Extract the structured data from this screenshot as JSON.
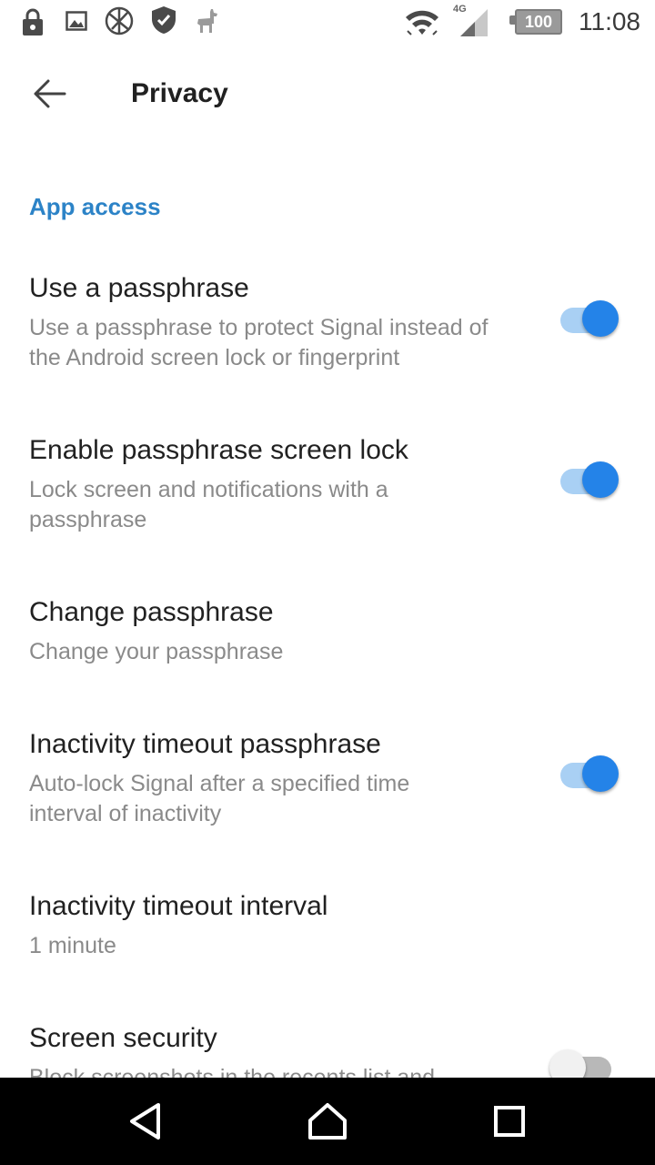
{
  "status_bar": {
    "time": "11:08",
    "battery": "100",
    "network_type": "4G",
    "icons": [
      "lock-icon",
      "image-icon",
      "globe-icon",
      "shield-icon",
      "llama-icon",
      "wifi-icon",
      "signal-icon",
      "battery-icon"
    ]
  },
  "toolbar": {
    "title": "Privacy",
    "back_icon": "back-arrow-icon"
  },
  "section": {
    "header": "App access"
  },
  "preferences": [
    {
      "title": "Use a passphrase",
      "summary": "Use a passphrase to protect Signal instead of the Android screen lock or fingerprint",
      "switch": true
    },
    {
      "title": "Enable passphrase screen lock",
      "summary": "Lock screen and notifications with a passphrase",
      "switch": true
    },
    {
      "title": "Change passphrase",
      "summary": "Change your passphrase",
      "switch": null
    },
    {
      "title": "Inactivity timeout passphrase",
      "summary": "Auto-lock Signal after a specified time interval of inactivity",
      "switch": true
    },
    {
      "title": "Inactivity timeout interval",
      "summary": "1 minute",
      "switch": null
    },
    {
      "title": "Screen security",
      "summary": "Block screenshots in the recents list and",
      "switch": false
    }
  ],
  "colors": {
    "accent": "#2c83c7",
    "switch_on_thumb": "#2483e8",
    "switch_on_track": "#a9d0f4",
    "summary_text": "#8a8a8a"
  },
  "navbar": {
    "icons": [
      "back-triangle-icon",
      "home-icon",
      "recents-icon"
    ]
  }
}
